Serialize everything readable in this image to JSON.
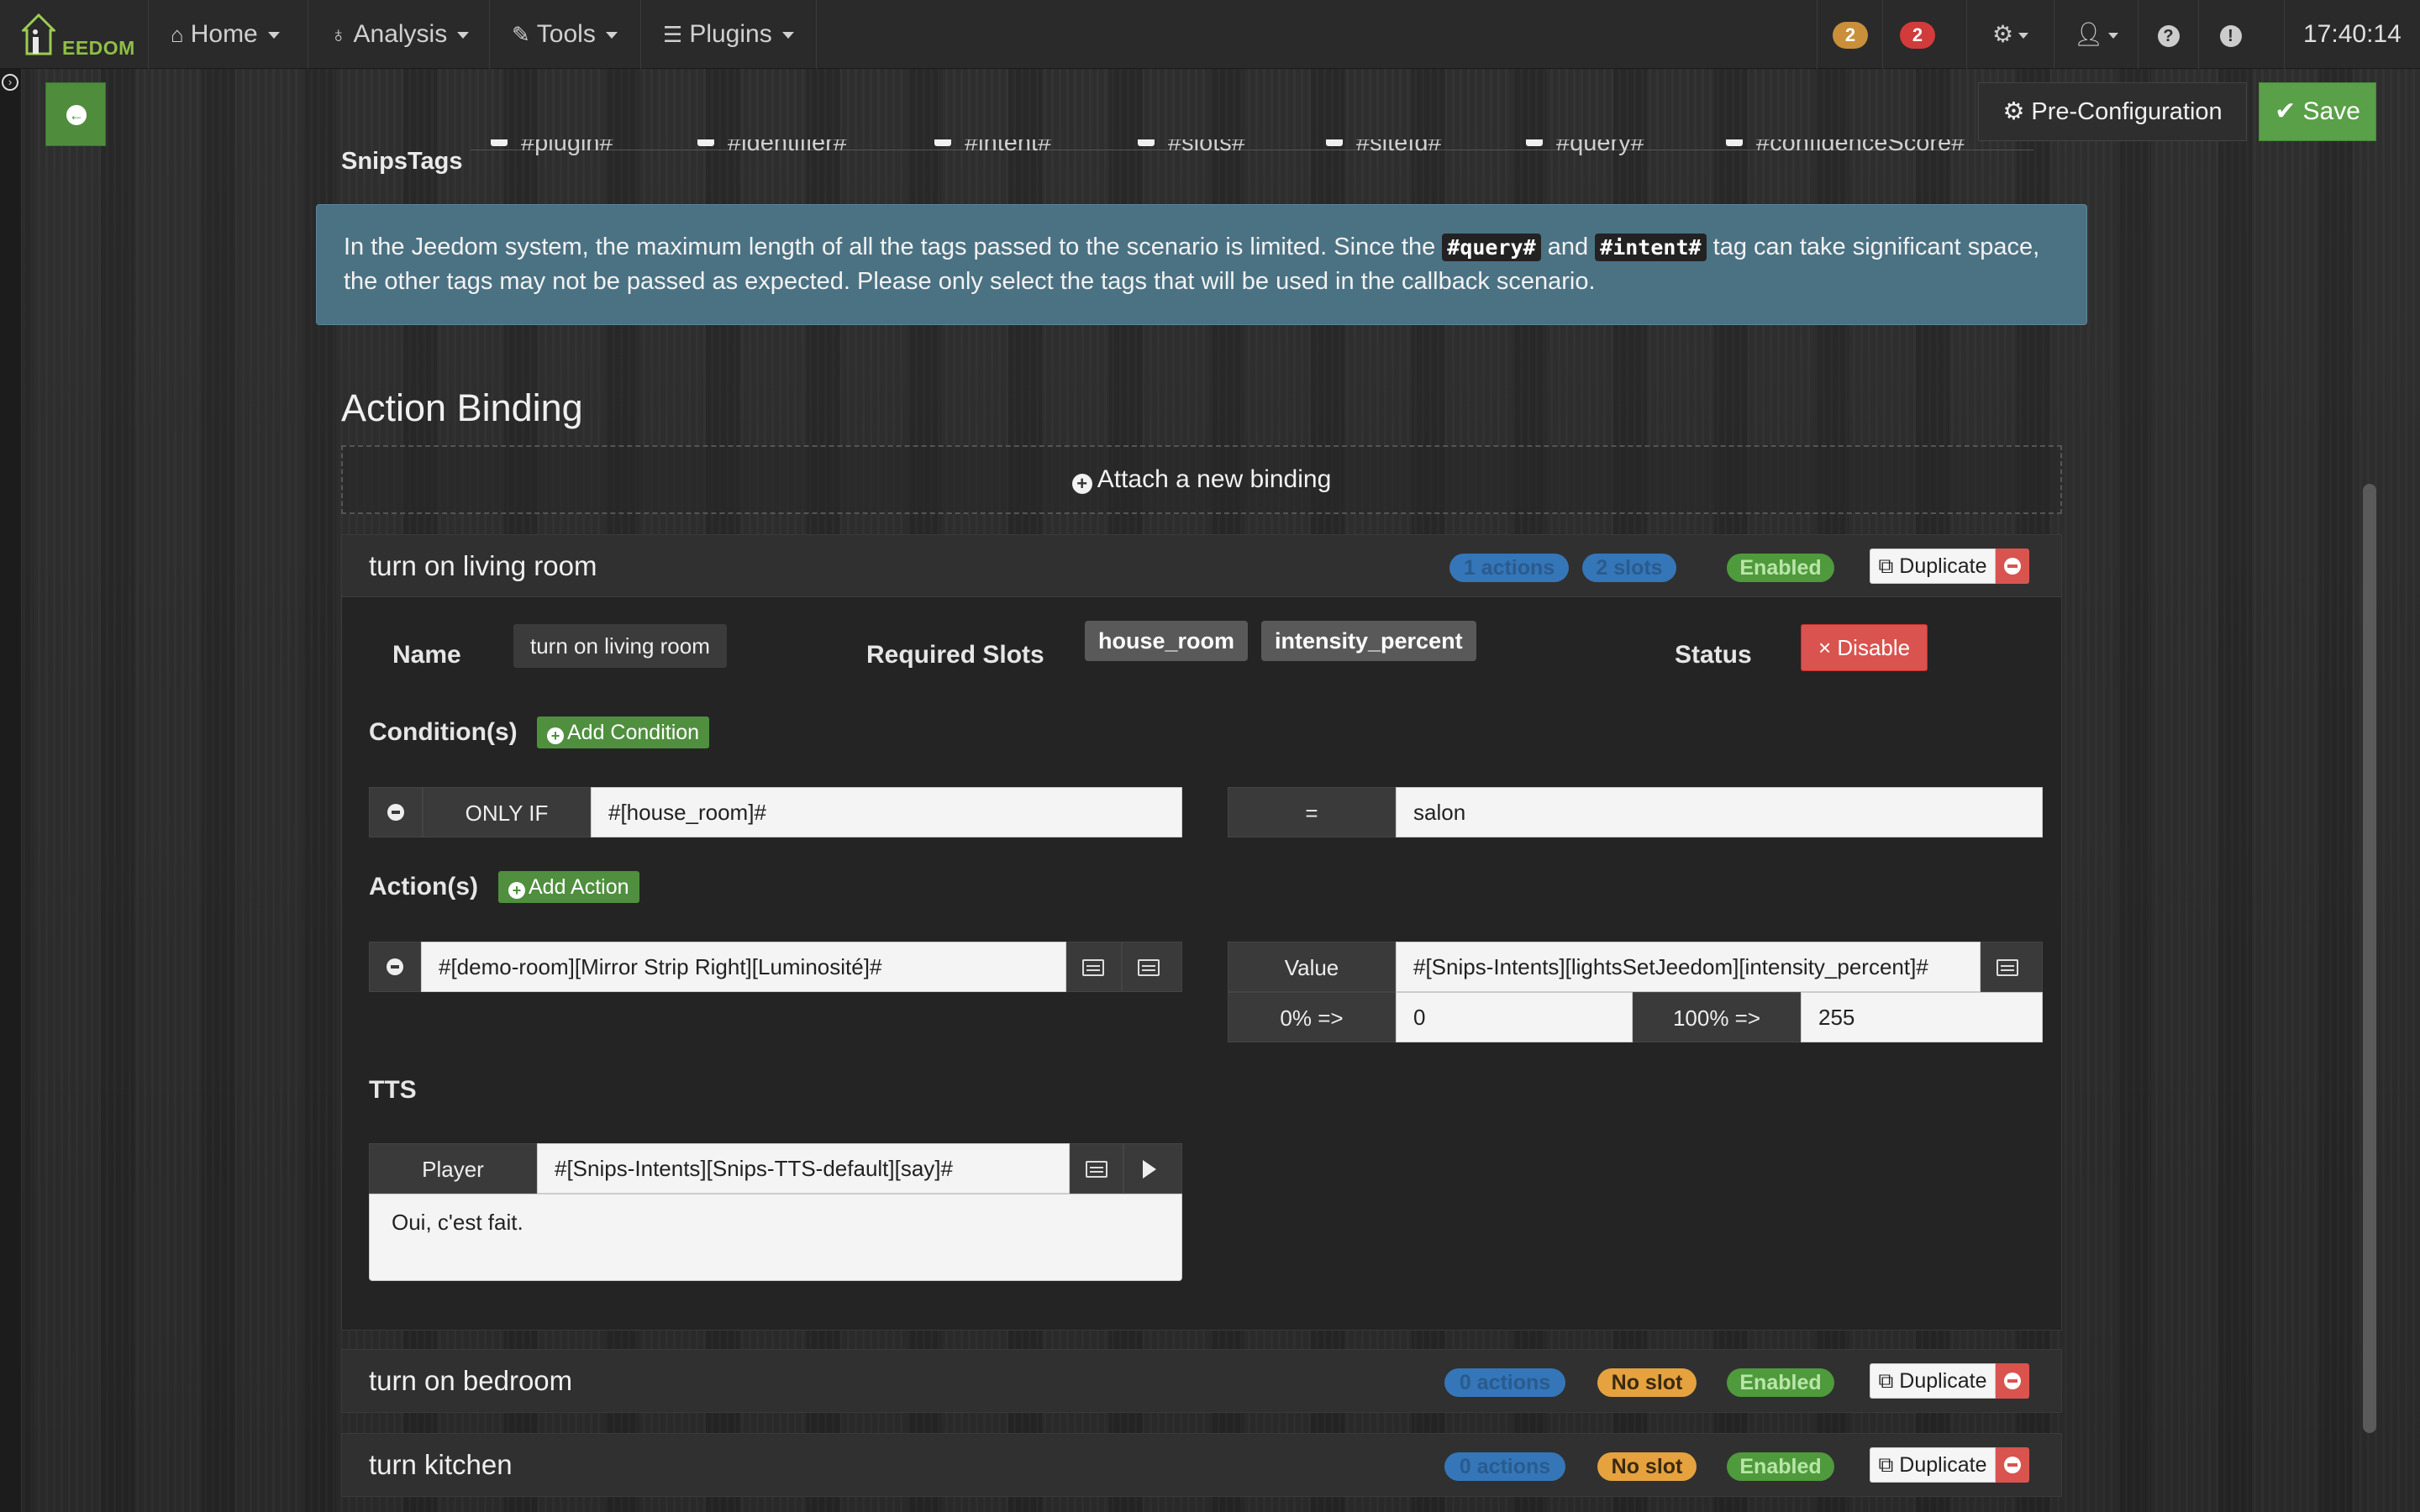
{
  "navbar": {
    "brand": "EEDOM",
    "menus": [
      {
        "label": "Home",
        "icon": "home-icon"
      },
      {
        "label": "Analysis",
        "icon": "stethoscope-icon"
      },
      {
        "label": "Tools",
        "icon": "wrench-icon"
      },
      {
        "label": "Plugins",
        "icon": "tasks-icon"
      }
    ],
    "badge_orange": "2",
    "badge_red": "2",
    "clock": "17:40:14",
    "colors": {
      "orange": "#c98f3a",
      "red": "#d13b3b"
    }
  },
  "toolbar": {
    "pre_configuration": "Pre-Configuration",
    "save": "Save"
  },
  "snips_tags": {
    "label": "SnipsTags",
    "tags": [
      "#plugin#",
      "#identifier#",
      "#intent#",
      "#slots#",
      "#siteId#",
      "#query#",
      "#confidenceScore#"
    ]
  },
  "alert": {
    "text_1": "In the Jeedom system, the maximum length of all the tags passed to the scenario is limited. Since the",
    "code_1": "#query#",
    "text_2": "and",
    "code_2": "#intent#",
    "text_3": "tag can take significant space, the other tags may not be passed as expected. Please only select the tags that will be used in the callback scenario."
  },
  "action_binding": {
    "title": "Action Binding",
    "attach_label": "Attach a new binding"
  },
  "bindings": [
    {
      "title": "turn on living room",
      "actions_badge": "1 actions",
      "slots_badge": "2 slots",
      "status_badge": "Enabled",
      "duplicate": "Duplicate",
      "name_label": "Name",
      "name_value": "turn on living room",
      "required_slots_label": "Required Slots",
      "slots": [
        "house_room",
        "intensity_percent"
      ],
      "status_label": "Status",
      "disable_label": "× Disable",
      "conditions_label": "Condition(s)",
      "add_condition": "Add Condition",
      "condition": {
        "prefix": "ONLY IF",
        "left": "#[house_room]#",
        "operator": "=",
        "right": "salon"
      },
      "actions_label": "Action(s)",
      "add_action": "Add Action",
      "action": {
        "command": "#[demo-room][Mirror Strip Right][Luminosité]#",
        "value_label": "Value",
        "value": "#[Snips-Intents][lightsSetJeedom][intensity_percent]#",
        "min_label": "0% =>",
        "min_value": "0",
        "max_label": "100% =>",
        "max_value": "255"
      },
      "tts_label": "TTS",
      "tts": {
        "player_label": "Player",
        "player": "#[Snips-Intents][Snips-TTS-default][say]#",
        "message": "Oui, c'est fait."
      }
    },
    {
      "title": "turn on bedroom",
      "actions_badge": "0 actions",
      "slots_badge": "No slot",
      "status_badge": "Enabled",
      "duplicate": "Duplicate"
    },
    {
      "title": "turn kitchen",
      "actions_badge": "0 actions",
      "slots_badge": "No slot",
      "status_badge": "Enabled",
      "duplicate": "Duplicate"
    }
  ]
}
